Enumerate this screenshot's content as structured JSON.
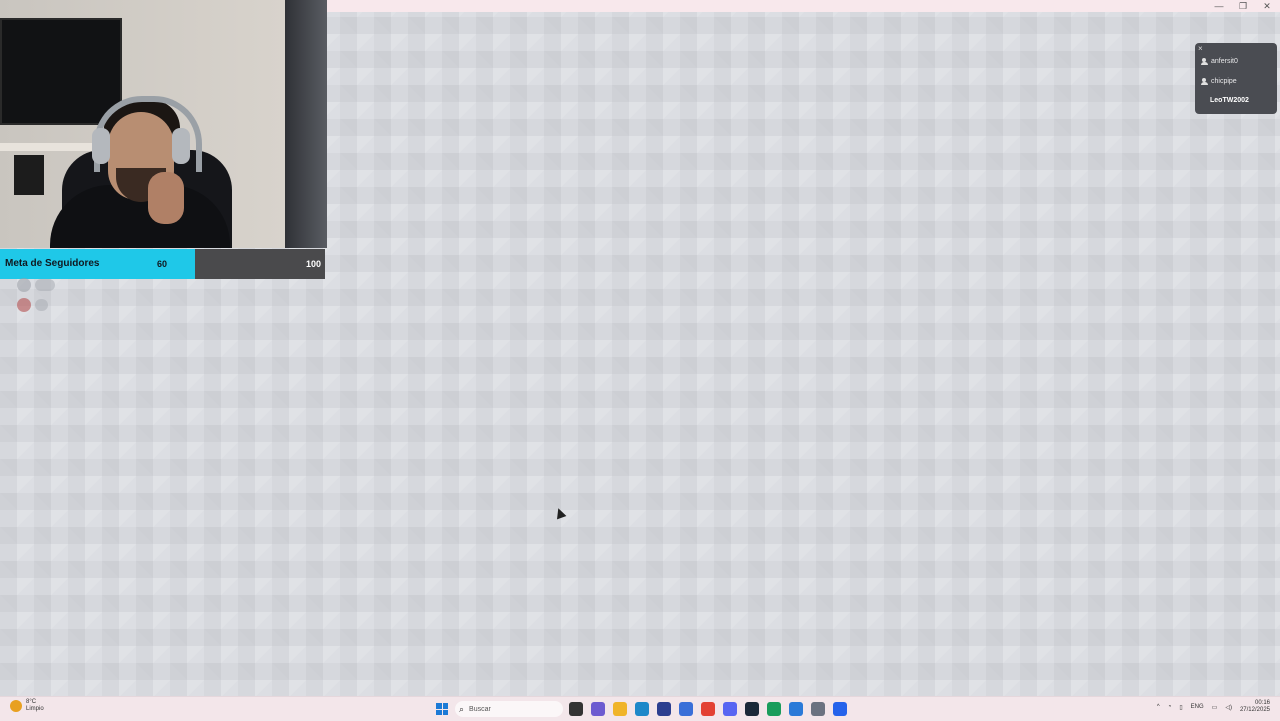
{
  "window": {
    "controls": [
      "—",
      "❐",
      "✕"
    ]
  },
  "follower_goal": {
    "label": "Meta de Seguidores",
    "current": "60",
    "target": "100",
    "progress": 0.6,
    "fill_color": "#1fc8e8"
  },
  "viewers": {
    "close": "×",
    "users": [
      "anfersit0",
      "chicpipe"
    ],
    "highlight": "LeoTW2002"
  },
  "taskbar": {
    "weather_temp": "8°C",
    "weather_desc": "Limpio",
    "search_placeholder": "Buscar",
    "language": "ENG",
    "time": "00:16",
    "date": "27/12/2025",
    "apps": [
      "task-view",
      "copilot",
      "file-explorer",
      "edge",
      "store",
      "mail",
      "chrome",
      "discord",
      "steam",
      "app-green",
      "app-blue",
      "settings",
      "app-active"
    ],
    "app_colors": [
      "#333333",
      "#6d5bd0",
      "#f0b429",
      "#1e88c9",
      "#2c3e8f",
      "#3a6fd8",
      "#e34133",
      "#5865f2",
      "#1b2838",
      "#1a9c5b",
      "#2b7ad8",
      "#6b7280",
      "#2563eb"
    ]
  }
}
